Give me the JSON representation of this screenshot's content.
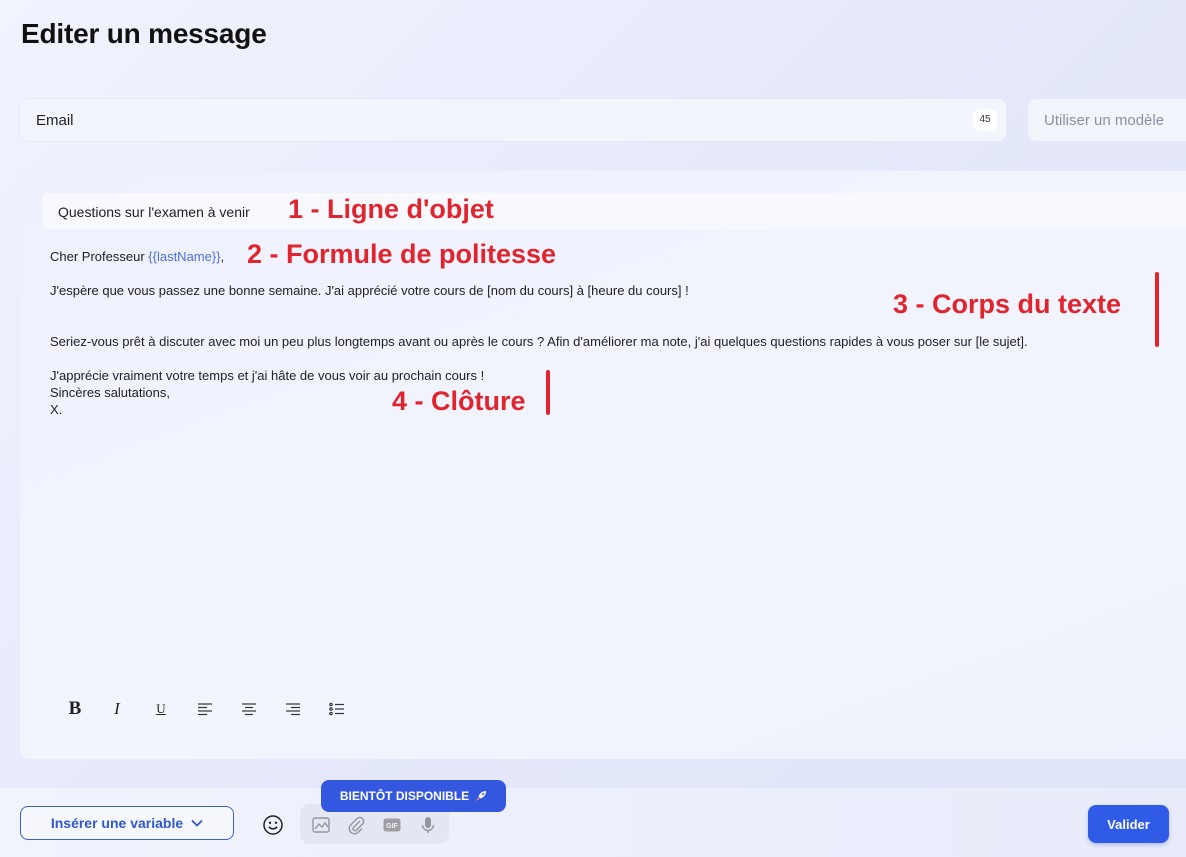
{
  "page": {
    "title": "Editer un message"
  },
  "channel": {
    "value": "Email",
    "count": "45"
  },
  "template": {
    "placeholder": "Utiliser un modèle"
  },
  "editor": {
    "subject": "Questions sur l'examen à venir",
    "greeting_prefix": "Cher Professeur ",
    "greeting_variable": "{{lastName}}",
    "greeting_suffix": ",",
    "paragraph1": "J'espère que vous passez une bonne semaine. J'ai apprécié votre cours de [nom du cours] à [heure du cours] !",
    "paragraph2": "Seriez-vous prêt à discuter avec moi un peu plus longtemps avant ou après le cours ? Afin d'améliorer ma note, j'ai quelques questions rapides à vous poser sur [le sujet].",
    "closing_line1": "J'apprécie vraiment votre temps et j'ai hâte de vous voir au prochain cours !",
    "closing_line2": "Sincères salutations,",
    "closing_line3": "X."
  },
  "annotations": {
    "subject": "1 - Ligne d'objet",
    "greeting": "2 - Formule de politesse",
    "body": "3 - Corps du texte",
    "closing": "4 - Clôture",
    "color": "#e0252f"
  },
  "toolbar": {
    "bold": "B",
    "italic": "I",
    "underline": "U",
    "icons": [
      "align-left-icon",
      "align-center-icon",
      "align-right-icon",
      "bullet-list-icon"
    ]
  },
  "bottom": {
    "insert_variable": "Insérer une variable",
    "coming_soon": "BIENTÔT DISPONIBLE",
    "validate": "Valider",
    "gif": "GIF",
    "media_icons": [
      "image-icon",
      "paperclip-icon",
      "gif-icon",
      "microphone-icon"
    ]
  },
  "colors": {
    "accent": "#2f5be6",
    "badge": "#3457e0",
    "variable": "#4a70d6"
  }
}
